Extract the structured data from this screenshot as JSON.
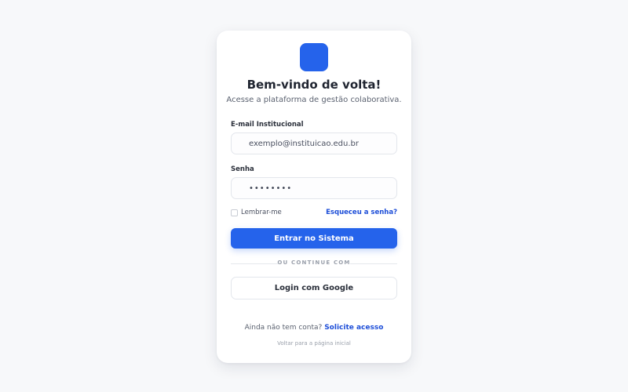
{
  "header": {
    "title": "Bem-vindo de volta!",
    "subtitle": "Acesse a plataforma de gestão colaborativa."
  },
  "form": {
    "email_label": "E-mail Institucional",
    "email_value": "exemplo@instituicao.edu.br",
    "password_label": "Senha",
    "password_value": "••••••••",
    "remember_label": "Lembrar-me",
    "forgot_label": "Esqueceu a senha?",
    "submit_label": "Entrar no Sistema"
  },
  "divider": {
    "label": "OU CONTINUE COM"
  },
  "social": {
    "google_label": "Login com Google"
  },
  "footer": {
    "no_account_text": "Ainda não tem conta?",
    "request_access_label": "Solicite acesso",
    "back_label": "Voltar para a página inicial"
  },
  "colors": {
    "accent": "#2563eb",
    "link": "#1d4ed8",
    "background": "#f7f8fa"
  },
  "icons": {
    "logo": "app-logo-square"
  }
}
